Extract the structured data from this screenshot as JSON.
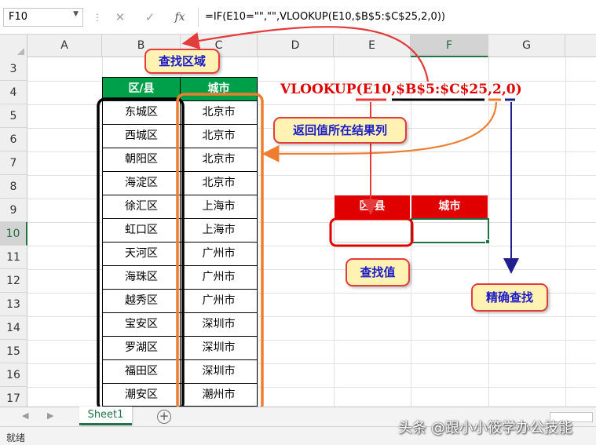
{
  "formula_bar": {
    "name_box": "F10",
    "cancel_icon": "✕",
    "enter_icon": "✓",
    "fx_label": "fx",
    "formula": "=IF(E10=\"\",\"\",VLOOKUP(E10,$B$5:$C$25,2,0))"
  },
  "columns": [
    "A",
    "B",
    "C",
    "D",
    "E",
    "F",
    "G"
  ],
  "rows": [
    "3",
    "4",
    "5",
    "6",
    "7",
    "8",
    "9",
    "10",
    "11",
    "12",
    "13",
    "14",
    "15",
    "16",
    "17"
  ],
  "active_cell": {
    "column": "F",
    "row": "10"
  },
  "lookup_table": {
    "headers": [
      "区/县",
      "城市"
    ],
    "rows": [
      [
        "东城区",
        "北京市"
      ],
      [
        "西城区",
        "北京市"
      ],
      [
        "朝阳区",
        "北京市"
      ],
      [
        "海淀区",
        "北京市"
      ],
      [
        "徐汇区",
        "上海市"
      ],
      [
        "虹口区",
        "上海市"
      ],
      [
        "天河区",
        "广州市"
      ],
      [
        "海珠区",
        "广州市"
      ],
      [
        "越秀区",
        "广州市"
      ],
      [
        "宝安区",
        "深圳市"
      ],
      [
        "罗湖区",
        "深圳市"
      ],
      [
        "福田区",
        "深圳市"
      ],
      [
        "潮安区",
        "潮州市"
      ]
    ]
  },
  "query_table": {
    "headers": [
      "区/县",
      "城市"
    ],
    "values": [
      "",
      ""
    ]
  },
  "annotations": {
    "formula_text": "VLOOKUP(E10,$B$5:$C$25,2,0)",
    "lookup_range": "查找区域",
    "return_column": "返回值所在结果列",
    "lookup_value": "查找值",
    "exact_match": "精确查找"
  },
  "sheet_tabs": [
    "Sheet1"
  ],
  "status": "就绪",
  "watermark": "头条 @跟小小筱学办公技能",
  "colors": {
    "header_green": "#00a04b",
    "header_red": "#e00000",
    "excel_green": "#217346",
    "callout_fill": "#fff2b3",
    "callout_border": "#e23c3c",
    "callout_text": "#1d1dc8",
    "orange_frame": "#ed7d31",
    "navy_arrow": "#1f1f8f"
  }
}
